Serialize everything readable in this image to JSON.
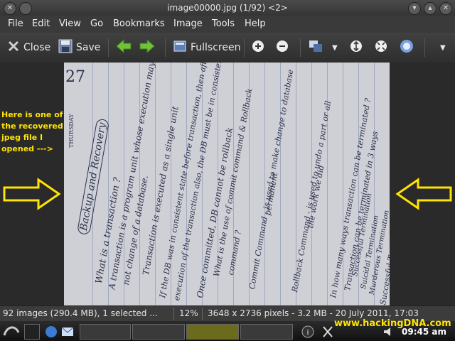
{
  "window": {
    "title": "image00000.jpg (1/92) <2>"
  },
  "menubar": {
    "items": [
      "File",
      "Edit",
      "View",
      "Go",
      "Bookmarks",
      "Image",
      "Tools",
      "Help"
    ]
  },
  "toolbar": {
    "close_label": "Close",
    "save_label": "Save",
    "fullscreen_label": "Fullscreen"
  },
  "annotation": {
    "text": "Here is one of the recovered jpeg file I opened --->"
  },
  "notebook": {
    "page_number": "27",
    "weekday": "THURSDAY",
    "lines": [
      "Backup and Recovery",
      "What is a transaction ?",
      "A transaction is a program unit whose execution may or",
      "not change of a database.",
      "Transaction is executed as a single unit",
      "If the DB was in consistent state before transaction, then after",
      "execution of the transaction also, the DB must be in consistent state.",
      "Once committed, DB cannot be rollback",
      "What is the use of commit command & Rollback",
      "command ?",
      "Commit Command - is used to make change to database",
      "permanent",
      "Rollback Command - is used to undo a part or all",
      "the work we did",
      "In how many ways transaction can be terminated ?",
      "Transaction can be terminated in 3 ways",
      "Successful Termination",
      "Suicidal Termination",
      "Murderous Termination",
      "Successful Termination"
    ]
  },
  "statusbar": {
    "selection": "92 images (290.4 MB), 1 selected ...",
    "zoom": "12%",
    "info": "3648 x 2736 pixels - 3.2 MB - 20 July 2011, 17:03"
  },
  "taskbar": {
    "watermark": "www.hackingDNA.com",
    "clock": "09:45 am"
  },
  "colors": {
    "annotation": "#ffe400",
    "toolbar_bg": "#3a3a3a",
    "arrow_green": "#6fc23a"
  }
}
